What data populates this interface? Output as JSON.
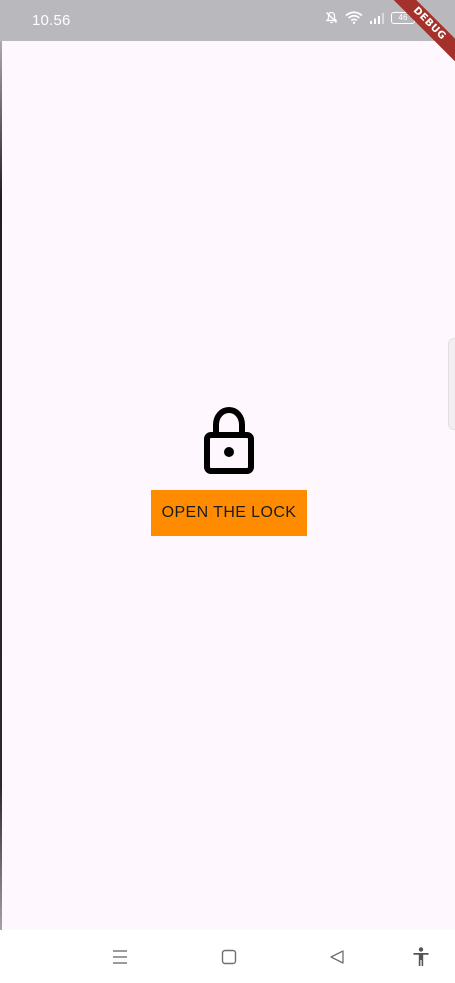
{
  "status_bar": {
    "time": "10.56",
    "battery_level": "46",
    "icons": [
      "mute-icon",
      "wifi-icon",
      "signal-icon",
      "battery-icon",
      "charging-icon"
    ]
  },
  "debug_banner": {
    "label": "DEBUG",
    "color": "#a4322a"
  },
  "main": {
    "lock_icon": "lock-icon",
    "button_label": "OPEN THE LOCK",
    "button_color": "#ff8c00"
  },
  "nav_bar": {
    "items": [
      "menu-icon",
      "home-icon",
      "back-icon",
      "accessibility-icon"
    ]
  }
}
